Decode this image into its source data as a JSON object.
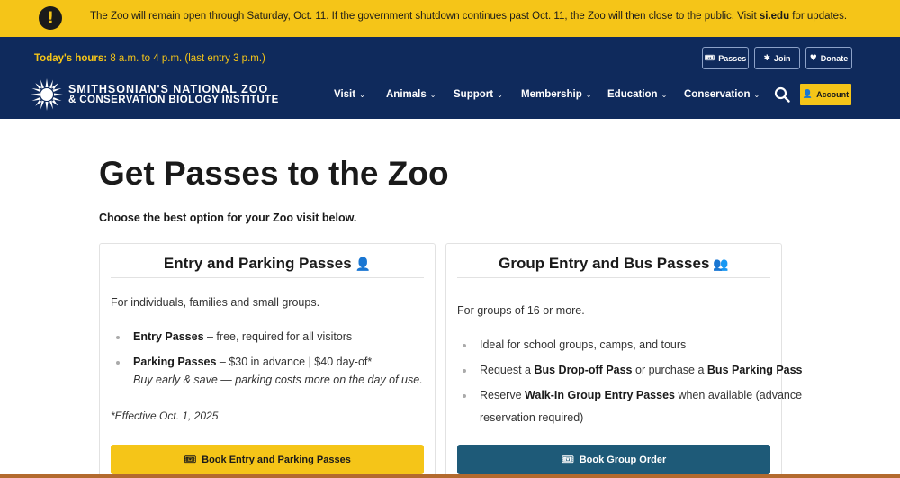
{
  "alert": {
    "text_before": "The Zoo will remain open through Saturday, Oct. 11. If the government shutdown continues past Oct. 11, the Zoo will then close to the public. Visit ",
    "link": "si.edu",
    "text_after": " for updates.",
    "icon": "exclamation-icon"
  },
  "header": {
    "hours_label": "Today's hours:",
    "hours_value": " 8 a.m. to 4  p.m. (last entry 3 p.m.)",
    "utility": [
      {
        "label": "Passes",
        "icon": "ticket-icon"
      },
      {
        "label": "Join",
        "icon": "paw-icon"
      },
      {
        "label": "Donate",
        "icon": "heart-icon"
      }
    ],
    "logo_line1": "SMITHSONIAN'S NATIONAL ZOO",
    "logo_line2": "& CONSERVATION BIOLOGY INSTITUTE",
    "nav": [
      "Visit",
      "Animals",
      "Support",
      "Membership",
      "Education",
      "Conservation"
    ],
    "account_label": "Account"
  },
  "main": {
    "title": "Get Passes to the Zoo",
    "intro": "Choose the best option for your Zoo visit below."
  },
  "cards": [
    {
      "title": "Entry and Parking Passes",
      "icon": "person-icon",
      "desc": "For individuals, families and small groups.",
      "items": [
        {
          "bold": "Entry Passes",
          "text": " – free, required for all visitors"
        },
        {
          "bold": "Parking Passes",
          "text": " – $30 in advance | $40 day-of*",
          "sub": "Buy early & save — parking costs more on the day of use."
        }
      ],
      "note": "*Effective Oct. 1, 2025",
      "cta": "Book Entry and Parking Passes"
    },
    {
      "title": "Group Entry and Bus Passes",
      "icon": "group-icon",
      "desc": "For groups of 16 or more.",
      "items": [
        {
          "text": "Ideal for school groups, camps, and tours"
        },
        {
          "pre": "Request a ",
          "bold": "Bus Drop-off Pass",
          "mid": " or purchase a ",
          "bold2": "Bus Parking Pass"
        },
        {
          "pre": "Reserve ",
          "bold": "Walk-In Group Entry Passes",
          "mid": " when available (advance",
          "line2": "reservation required)"
        }
      ],
      "cta": "Book Group Order"
    }
  ],
  "colors": {
    "alert_bg": "#f5c518",
    "header_bg": "#0f2a5c",
    "accent_yellow": "#f5c518",
    "teal_button": "#1e5a78",
    "icon_blue": "#3a82c4"
  }
}
